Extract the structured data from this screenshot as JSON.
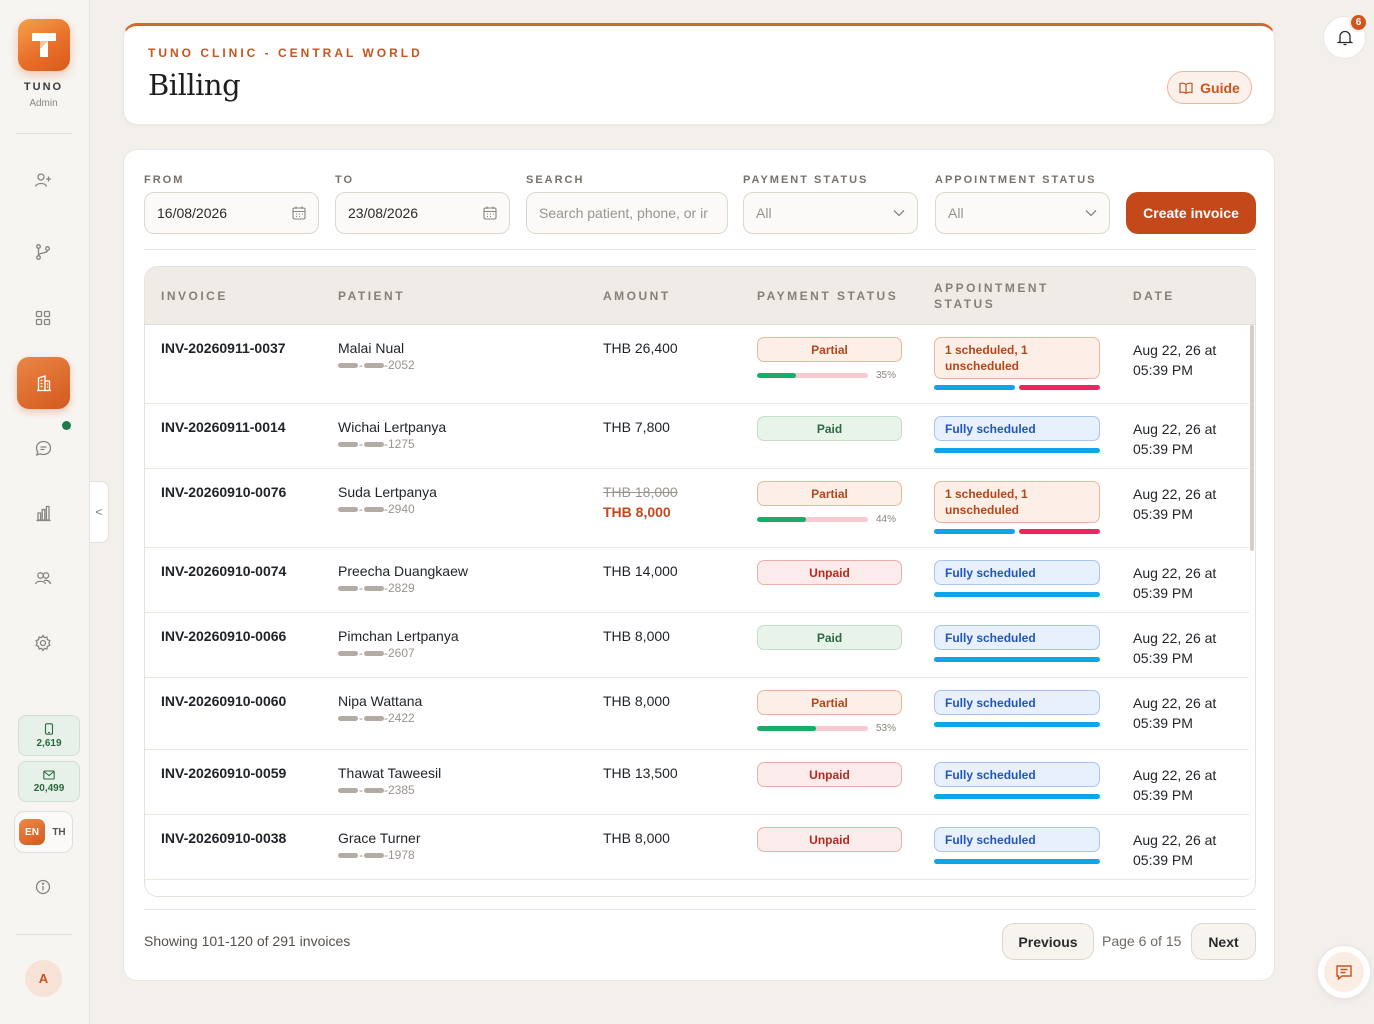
{
  "sidebar": {
    "brand": "TUNO",
    "role": "Admin",
    "nav_icons": [
      "user-plus-icon",
      "branch-icon",
      "grid-icon",
      "building-icon",
      "chat-icon",
      "bar-chart-icon",
      "users-icon",
      "gear-icon"
    ],
    "active_item": "building-icon",
    "sms_credits": "2,619",
    "email_credits": "20,499",
    "lang_en": "EN",
    "lang_th": "TH",
    "collapse_label": "<",
    "avatar_initial": "A"
  },
  "header": {
    "clinic": "TUNO CLINIC - CENTRAL WORLD",
    "title": "Billing",
    "guide_label": "Guide"
  },
  "notifications": {
    "count": "6"
  },
  "filters": {
    "from_label": "FROM",
    "from_value": "16/08/2026",
    "to_label": "TO",
    "to_value": "23/08/2026",
    "search_label": "SEARCH",
    "search_placeholder": "Search patient, phone, or ir",
    "payment_label": "PAYMENT STATUS",
    "payment_value": "All",
    "appointment_label": "APPOINTMENT STATUS",
    "appointment_value": "All",
    "create_label": "Create invoice"
  },
  "table": {
    "headers": {
      "invoice": "INVOICE",
      "patient": "PATIENT",
      "amount": "AMOUNT",
      "payment": "PAYMENT STATUS",
      "appointment": "APPOINTMENT STATUS",
      "date": "DATE"
    },
    "rows": [
      {
        "invoice": "INV-20260911-0037",
        "patient": "Malai Nual",
        "phone": "-2052",
        "amount": "THB 26,400",
        "payment": "Partial",
        "paid_pct": "35%",
        "paid_fraction": 0.35,
        "appt": "1 scheduled, 1 unscheduled",
        "date_line1": "Aug 22, 26 at",
        "date_line2": "05:39 PM"
      },
      {
        "invoice": "INV-20260911-0014",
        "patient": "Wichai Lertpanya",
        "phone": "-1275",
        "amount": "THB 7,800",
        "payment": "Paid",
        "appt": "Fully scheduled",
        "date_line1": "Aug 22, 26 at",
        "date_line2": "05:39 PM"
      },
      {
        "invoice": "INV-20260910-0076",
        "patient": "Suda Lertpanya",
        "phone": "-2940",
        "amount_old": "THB 18,000",
        "amount_new": "THB 8,000",
        "payment": "Partial",
        "paid_pct": "44%",
        "paid_fraction": 0.44,
        "appt": "1 scheduled, 1 unscheduled",
        "date_line1": "Aug 22, 26 at",
        "date_line2": "05:39 PM"
      },
      {
        "invoice": "INV-20260910-0074",
        "patient": "Preecha Duangkaew",
        "phone": "-2829",
        "amount": "THB 14,000",
        "payment": "Unpaid",
        "appt": "Fully scheduled",
        "date_line1": "Aug 22, 26 at",
        "date_line2": "05:39 PM"
      },
      {
        "invoice": "INV-20260910-0066",
        "patient": "Pimchan Lertpanya",
        "phone": "-2607",
        "amount": "THB 8,000",
        "payment": "Paid",
        "appt": "Fully scheduled",
        "date_line1": "Aug 22, 26 at",
        "date_line2": "05:39 PM"
      },
      {
        "invoice": "INV-20260910-0060",
        "patient": "Nipa Wattana",
        "phone": "-2422",
        "amount": "THB 8,000",
        "payment": "Partial",
        "paid_pct": "53%",
        "paid_fraction": 0.53,
        "appt": "Fully scheduled",
        "date_line1": "Aug 22, 26 at",
        "date_line2": "05:39 PM"
      },
      {
        "invoice": "INV-20260910-0059",
        "patient": "Thawat Taweesil",
        "phone": "-2385",
        "amount": "THB 13,500",
        "payment": "Unpaid",
        "appt": "Fully scheduled",
        "date_line1": "Aug 22, 26 at",
        "date_line2": "05:39 PM"
      },
      {
        "invoice": "INV-20260910-0038",
        "patient": "Grace Turner",
        "phone": "-1978",
        "amount": "THB 8,000",
        "payment": "Unpaid",
        "appt": "Fully scheduled",
        "date_line1": "Aug 22, 26 at",
        "date_line2": "05:39 PM"
      }
    ]
  },
  "footer": {
    "showing": "Showing 101-120 of 291 invoices",
    "prev_label": "Previous",
    "page_info": "Page 6 of 15",
    "next_label": "Next"
  },
  "colors": {
    "accent": "#c5481a",
    "scheduled_bar": "#0ea5e9",
    "unscheduled_bar": "#f0245e",
    "paid_progress": "#1eab6a"
  }
}
